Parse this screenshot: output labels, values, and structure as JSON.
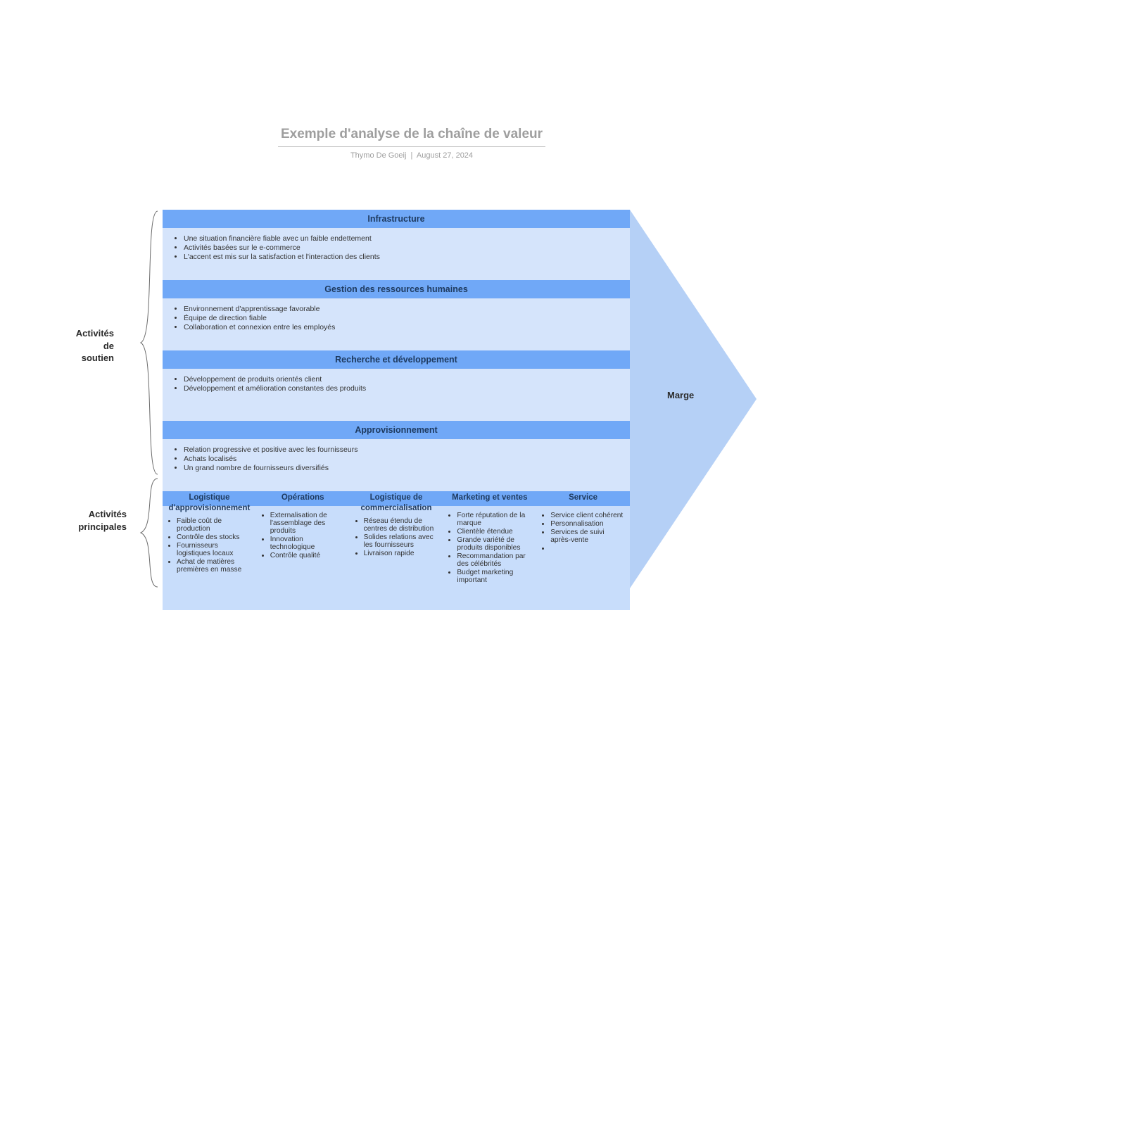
{
  "title": "Exemple d'analyse de la chaîne de valeur",
  "author": "Thymo De Goeij",
  "date": "August 27, 2024",
  "labels": {
    "support": "Activités\nde\nsoutien",
    "primary": "Activités\nprincipales",
    "margin": "Marge"
  },
  "support": [
    {
      "title": "Infrastructure",
      "items": [
        "Une situation financière fiable avec un faible endettement",
        "Activités basées sur le e-commerce",
        "L'accent est mis sur la satisfaction et l'interaction des clients"
      ]
    },
    {
      "title": "Gestion des ressources humaines",
      "items": [
        "Environnement d'apprentissage favorable",
        "Équipe de direction fiable",
        "Collaboration et connexion entre les employés"
      ]
    },
    {
      "title": "Recherche et développement",
      "items": [
        "Développement de produits orientés client",
        "Développement et amélioration constantes des produits"
      ]
    },
    {
      "title": "Approvisionnement",
      "items": [
        "Relation progressive et positive avec les fournisseurs",
        "Achats localisés",
        "Un grand nombre de fournisseurs diversifiés"
      ]
    }
  ],
  "primary": [
    {
      "title": "Logistique",
      "title2": "d'approvisionnement",
      "items": [
        "Faible coût de production",
        "Contrôle des stocks",
        "Fournisseurs logistiques locaux",
        "Achat de matières premières en masse"
      ]
    },
    {
      "title": "Opérations",
      "title2": "",
      "items": [
        "Externalisation de l'assemblage des produits",
        "Innovation technologique",
        "Contrôle qualité"
      ]
    },
    {
      "title": "Logistique de",
      "title2": "commercialisation",
      "items": [
        "Réseau étendu de centres de distribution",
        "Solides relations avec les fournisseurs",
        "Livraison rapide"
      ]
    },
    {
      "title": "Marketing et ventes",
      "title2": "",
      "items": [
        "Forte réputation de la marque",
        "Clientèle étendue",
        "Grande variété de produits disponibles",
        "Recommandation par des célébrités",
        "Budget marketing important"
      ]
    },
    {
      "title": "Service",
      "title2": "",
      "items": [
        "Service client cohérent",
        "Personnalisation",
        "Services de suivi après-vente",
        ""
      ]
    }
  ]
}
